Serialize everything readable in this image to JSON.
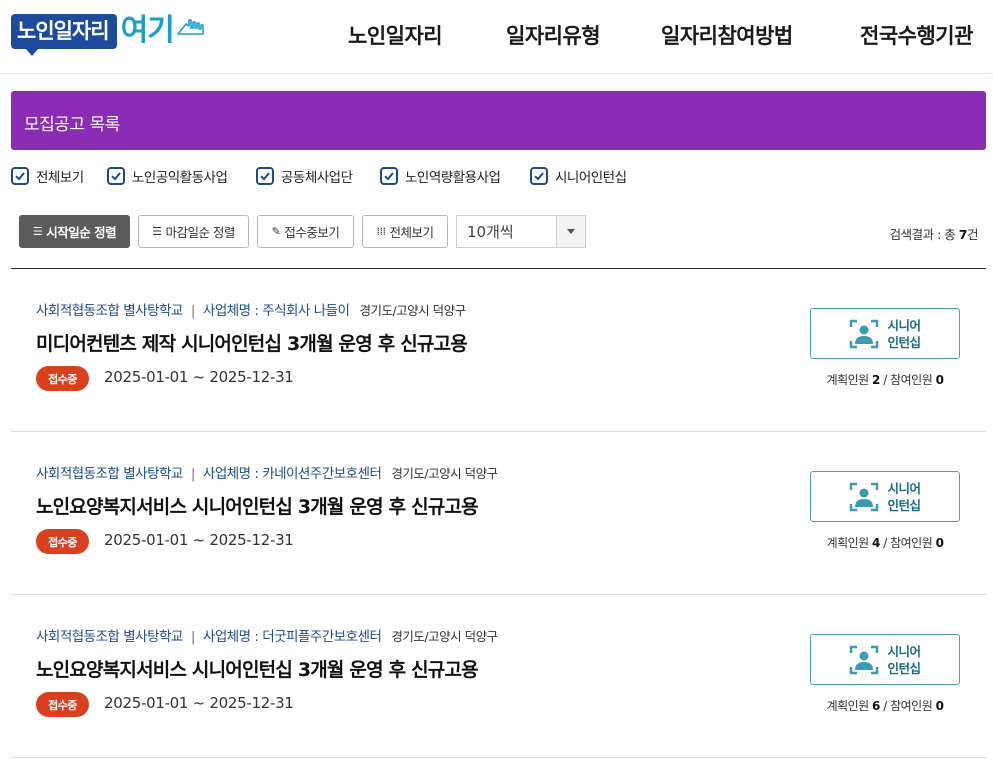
{
  "header": {
    "logo_box": "노인일자리",
    "logo_here": "여기",
    "nav": [
      {
        "label": "노인일자리"
      },
      {
        "label": "일자리유형"
      },
      {
        "label": "일자리참여방법"
      },
      {
        "label": "전국수행기관"
      }
    ]
  },
  "page": {
    "title": "모집공고 목록"
  },
  "filters": [
    {
      "label": "전체보기",
      "checked": true
    },
    {
      "label": "노인공익활동사업",
      "checked": true
    },
    {
      "label": "공동체사업단",
      "checked": true
    },
    {
      "label": "노인역량활용사업",
      "checked": true
    },
    {
      "label": "시니어인턴십",
      "checked": true
    }
  ],
  "toolbar": {
    "sort_start": "시작일순 정렬",
    "sort_end": "마감일순 정렬",
    "view_open": "접수중보기",
    "view_all": "전체보기",
    "page_size": "10개씩",
    "result_prefix": "검색결과 : 총 ",
    "result_count": "7",
    "result_suffix": "건"
  },
  "listings": [
    {
      "org": "사회적협동조합 별사탕학교",
      "biz_label": "사업체명 : ",
      "biz": "주식회사 나들이",
      "region": "경기도/고양시 덕양구",
      "title": "미디어컨텐츠 제작 시니어인턴십 3개월 운영 후 신규고용",
      "status": "접수중",
      "period": "2025-01-01 ~ 2025-12-31",
      "type_line1": "시니어",
      "type_line2": "인턴십",
      "planned_label": "계획인원 ",
      "planned": "2",
      "joined_label": " / 참여인원 ",
      "joined": "0"
    },
    {
      "org": "사회적협동조합 별사탕학교",
      "biz_label": "사업체명 : ",
      "biz": "카네이션주간보호센터",
      "region": "경기도/고양시 덕양구",
      "title": "노인요양복지서비스 시니어인턴십 3개월 운영 후 신규고용",
      "status": "접수중",
      "period": "2025-01-01 ~ 2025-12-31",
      "type_line1": "시니어",
      "type_line2": "인턴십",
      "planned_label": "계획인원 ",
      "planned": "4",
      "joined_label": " / 참여인원 ",
      "joined": "0"
    },
    {
      "org": "사회적협동조합 별사탕학교",
      "biz_label": "사업체명 : ",
      "biz": "더굿피플주간보호센터",
      "region": "경기도/고양시 덕양구",
      "title": "노인요양복지서비스 시니어인턴십 3개월 운영 후 신규고용",
      "status": "접수중",
      "period": "2025-01-01 ~ 2025-12-31",
      "type_line1": "시니어",
      "type_line2": "인턴십",
      "planned_label": "계획인원 ",
      "planned": "6",
      "joined_label": " / 참여인원 ",
      "joined": "0"
    }
  ],
  "colors": {
    "title_bar": "#8a2cb4",
    "logo_blue": "#1d4a9a",
    "logo_cyan": "#1aa0c6",
    "badge": "#d9411e",
    "link_blue": "#1c4d8c",
    "type_teal": "#1a6b80"
  }
}
